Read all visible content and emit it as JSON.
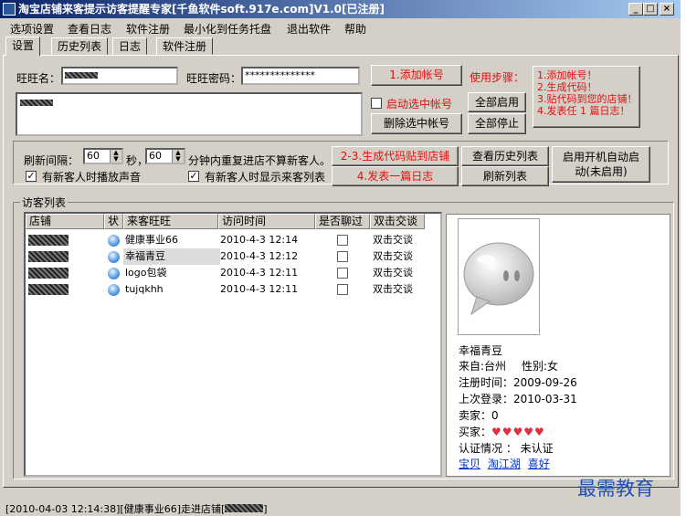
{
  "window": {
    "title": "淘宝店铺来客提示访客提醒专家[千鱼软件soft.917e.com]V1.0[已注册]"
  },
  "menu": [
    "选项设置",
    "查看日志",
    "软件注册",
    "最小化到任务托盘",
    "退出软件",
    "帮助"
  ],
  "tabs": [
    "设置",
    "历史列表",
    "日志",
    "软件注册"
  ],
  "settings": {
    "wangwang_label": "旺旺名：",
    "password_label": "旺旺密码：",
    "password_value": "**************",
    "add_account": "1.添加帐号",
    "steps_label": "使用步骤：",
    "steps": [
      "1.添加帐号！",
      "2.生成代码！",
      "3.贴代码到您的店铺！",
      "4.发表任 1 篇日志！"
    ],
    "auto_start_selected": "启动选中帐号",
    "start_all": "全部启用",
    "delete_selected": "删除选中帐号",
    "stop_all": "全部停止",
    "refresh_label": "刷新间隔：",
    "refresh_value": "60",
    "seconds": "秒，",
    "repeat_value": "60",
    "repeat_text": "分钟内重复进店不算新客人。",
    "gen_code": "2-3.生成代码贴到店铺",
    "view_history": "查看历史列表",
    "boot_start": "启用开机自动启动(未启用)",
    "sound_chk": "有新客人时播放声音",
    "show_chk": "有新客人时显示来客列表",
    "post_log": "4.发表一篇日志",
    "refresh_list": "刷新列表"
  },
  "visitors": {
    "group_label": "访客列表",
    "columns": [
      "店铺",
      "状",
      "来客旺旺",
      "访问时间",
      "是否聊过",
      "双击交谈"
    ],
    "rows": [
      {
        "name": "健康事业66",
        "time": "2010-4-3 12:14",
        "action": "双击交谈"
      },
      {
        "name": "幸福青豆",
        "time": "2010-4-3 12:12",
        "action": "双击交谈"
      },
      {
        "name": "logo包袋",
        "time": "2010-4-3 12:11",
        "action": "双击交谈"
      },
      {
        "name": "tujqkhh",
        "time": "2010-4-3 12:11",
        "action": "双击交谈"
      }
    ]
  },
  "profile": {
    "name": "幸福青豆",
    "from": "来自:台州",
    "gender": "性别:女",
    "reg_time": "注册时间：2009-09-26",
    "last_login": "上次登录：2010-03-31",
    "seller": "卖家：0",
    "buyer": "买家：",
    "hearts": "♥♥♥♥♥",
    "cert": "认证情况 ： 未认证",
    "links": [
      "宝贝",
      "淘江湖",
      "喜好"
    ]
  },
  "status": {
    "text": "[2010-04-03 12:14:38][健康事业66]走进店铺[",
    "text_end": "]"
  },
  "watermark": "最需教育"
}
